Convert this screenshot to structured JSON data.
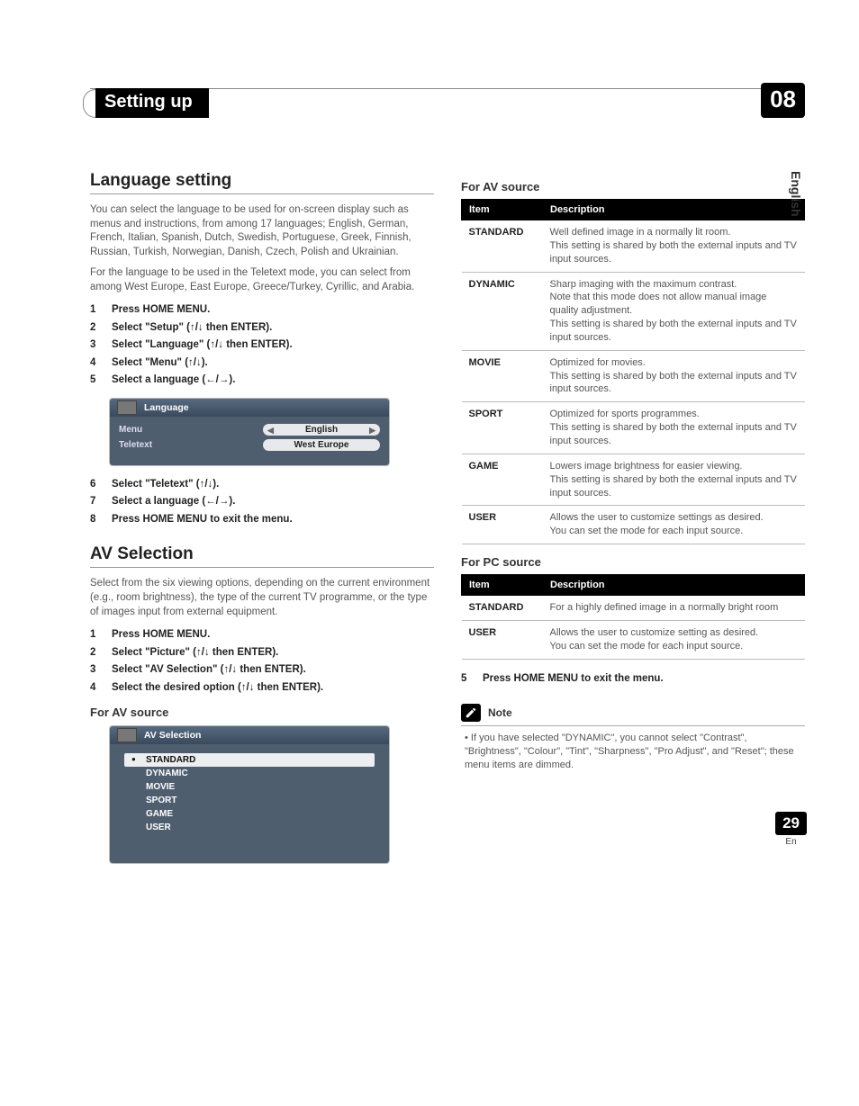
{
  "header": {
    "chapter_title": "Setting up",
    "chapter_number": "08",
    "side_language": "English"
  },
  "left": {
    "lang_heading": "Language setting",
    "lang_p1": "You can select the language to be used for on-screen display such as menus and instructions, from among 17 languages; English, German, French, Italian, Spanish, Dutch, Swedish, Portuguese, Greek, Finnish, Russian, Turkish, Norwegian, Danish, Czech, Polish and Ukrainian.",
    "lang_p2": "For the language to be used in the Teletext mode, you can select from among West Europe, East Europe, Greece/Turkey, Cyrillic, and Arabia.",
    "steps_a": [
      "Press HOME MENU.",
      "Select \"Setup\" (↑/↓ then ENTER).",
      "Select \"Language\" (↑/↓ then ENTER).",
      "Select \"Menu\" (↑/↓).",
      "Select a language (←/→)."
    ],
    "osd1": {
      "title": "Language",
      "rows": [
        {
          "label": "Menu",
          "value": "English",
          "arrows": true
        },
        {
          "label": "Teletext",
          "value": "West Europe",
          "arrows": false
        }
      ]
    },
    "steps_b_start": 6,
    "steps_b": [
      "Select \"Teletext\" (↑/↓).",
      "Select a language (←/→).",
      "Press HOME MENU to exit the menu."
    ],
    "av_heading": "AV Selection",
    "av_p1": "Select from the six viewing options, depending on the current environment (e.g., room brightness), the type of the current TV programme, or the type of images input from external equipment.",
    "av_steps": [
      "Press HOME MENU.",
      "Select \"Picture\" (↑/↓ then ENTER).",
      "Select \"AV Selection\" (↑/↓ then ENTER).",
      "Select the desired option (↑/↓ then ENTER)."
    ],
    "av_sub": "For AV source",
    "osd2": {
      "title": "AV Selection",
      "items": [
        "STANDARD",
        "DYNAMIC",
        "MOVIE",
        "SPORT",
        "GAME",
        "USER"
      ],
      "selected": 0
    }
  },
  "right": {
    "t1_title": "For AV source",
    "thead": {
      "item": "Item",
      "desc": "Description"
    },
    "t1_rows": [
      {
        "item": "STANDARD",
        "desc": "Well defined image in a normally lit room.\nThis setting is shared by both the external inputs and TV input sources."
      },
      {
        "item": "DYNAMIC",
        "desc": "Sharp imaging with the maximum contrast.\nNote that this mode does not allow manual image quality adjustment.\nThis setting is shared by both the external inputs and TV input sources."
      },
      {
        "item": "MOVIE",
        "desc": "Optimized for movies.\nThis setting is shared by both the external inputs and TV input sources."
      },
      {
        "item": "SPORT",
        "desc": "Optimized for sports programmes.\nThis setting is shared by both the external inputs and TV input sources."
      },
      {
        "item": "GAME",
        "desc": "Lowers image brightness for easier viewing.\nThis setting is shared by both the external inputs and TV input sources."
      },
      {
        "item": "USER",
        "desc": "Allows the user to customize settings as desired.\nYou can set the mode for each input source."
      }
    ],
    "t2_title": "For PC source",
    "t2_rows": [
      {
        "item": "STANDARD",
        "desc": "For a highly defined image in a normally bright room"
      },
      {
        "item": "USER",
        "desc": "Allows the user to customize setting as desired.\nYou can set the mode for each input source."
      }
    ],
    "step5_num": "5",
    "step5": "Press HOME MENU to exit the menu.",
    "note_label": "Note",
    "note_text": "If you have selected \"DYNAMIC\", you cannot select \"Contrast\", \"Brightness\", \"Colour\", \"Tint\", \"Sharpness\", \"Pro Adjust\", and \"Reset\"; these menu items are dimmed."
  },
  "footer": {
    "page": "29",
    "lang": "En"
  }
}
